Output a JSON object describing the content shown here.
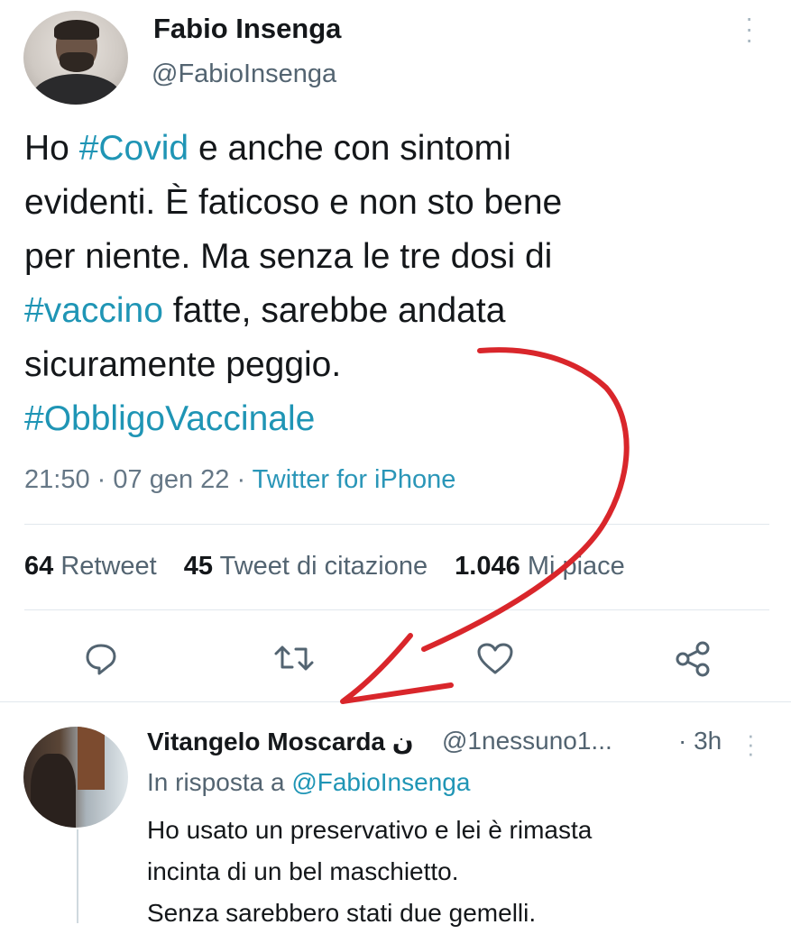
{
  "tweet": {
    "author_name": "Fabio Insenga",
    "author_handle": "@FabioInsenga",
    "text_lines": [
      {
        "pre": "Ho ",
        "tag": "#Covid",
        "post": " e anche con sintomi"
      },
      {
        "pre": "evidenti. È faticoso e non sto bene",
        "tag": "",
        "post": ""
      },
      {
        "pre": "per niente. Ma senza le tre dosi di",
        "tag": "",
        "post": ""
      },
      {
        "pre": "",
        "tag": "#vaccino",
        "post": " fatte, sarebbe andata"
      },
      {
        "pre": "sicuramente peggio.",
        "tag": "",
        "post": ""
      },
      {
        "pre": "",
        "tag": "#ObbligoVaccinale",
        "post": ""
      }
    ],
    "time": "21:50",
    "date": "07 gen 22",
    "source": "Twitter for iPhone",
    "separator": "·",
    "stats": {
      "retweets_count": "64",
      "retweets_label": "Retweet",
      "quotes_count": "45",
      "quotes_label": "Tweet di citazione",
      "likes_count": "1.046",
      "likes_label": "Mi piace"
    },
    "more_icon": "more-vertical-icon"
  },
  "actions": [
    {
      "name": "reply",
      "icon": "comment-icon"
    },
    {
      "name": "retweet",
      "icon": "retweet-icon"
    },
    {
      "name": "like",
      "icon": "heart-icon"
    },
    {
      "name": "share",
      "icon": "share-icon"
    }
  ],
  "reply_tweet": {
    "author_name": "Vitangelo Moscarda ن",
    "author_handle": "@1nessuno1...",
    "time": "· 3h",
    "in_reply_prefix": "In risposta a ",
    "in_reply_handle": "@FabioInsenga",
    "text_lines": [
      "Ho usato un preservativo e lei è rimasta",
      "incinta di un bel maschietto.",
      "Senza sarebbero stati due gemelli."
    ]
  },
  "colors": {
    "hashtag": "#1f95b5",
    "secondary_text": "#536471",
    "annotation_arrow": "#d9262b"
  }
}
